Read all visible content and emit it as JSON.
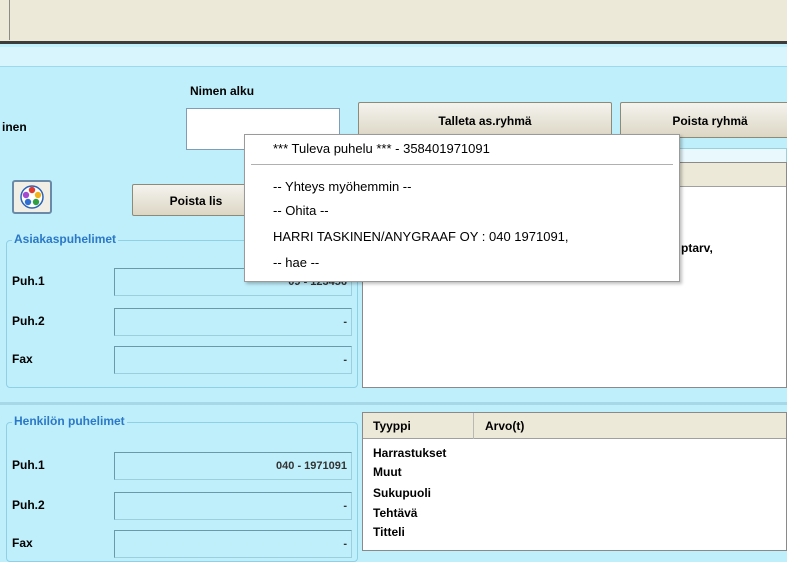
{
  "form": {
    "nimen_alku_label": "Nimen alku",
    "partial_label": "inen",
    "talleta_button": "Talleta as.ryhmä",
    "poista_ryhma_button": "Poista ryhmä",
    "poista_button": "Poista lis",
    "right_partial": "ptarv,"
  },
  "popup": {
    "header": "*** Tuleva puhelu ***  - 358401971091",
    "items": [
      "-- Yhteys myöhemmin --",
      "-- Ohita --",
      "HARRI TASKINEN/ANYGRAAF OY  : 040 1971091,",
      "-- hae --"
    ]
  },
  "customer_phones": {
    "title": "Asiakaspuhelimet",
    "rows": [
      {
        "label": "Puh.1",
        "value": "09 - 123456"
      },
      {
        "label": "Puh.2",
        "value": "-"
      },
      {
        "label": "Fax",
        "value": "-"
      }
    ]
  },
  "person_phones": {
    "title": "Henkilön puhelimet",
    "rows": [
      {
        "label": "Puh.1",
        "value": "040 - 1971091"
      },
      {
        "label": "Puh.2",
        "value": "-"
      },
      {
        "label": "Fax",
        "value": "-"
      }
    ]
  },
  "attributes": {
    "columns": [
      "Tyyppi",
      "Arvo(t)"
    ],
    "rows": [
      "Harrastukset",
      "Muut",
      "Sukupuoli",
      "Tehtävä",
      "Titteli"
    ]
  },
  "colors": {
    "background": "#bfeffb",
    "group_title": "#2b78c8"
  }
}
